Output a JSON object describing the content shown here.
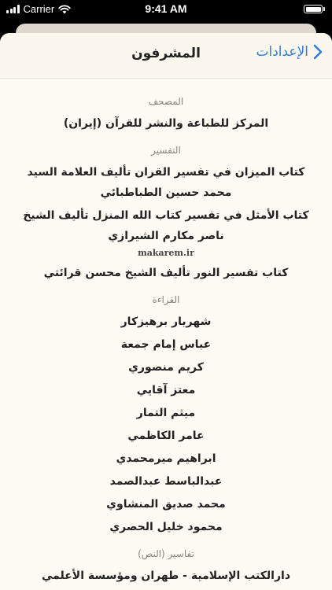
{
  "status_bar": {
    "carrier": "Carrier",
    "time": "9:41 AM",
    "battery_percent": 100,
    "icons": [
      "signal-bars-icon",
      "wifi-icon",
      "battery-icon"
    ]
  },
  "nav": {
    "title": "المشرفون",
    "back_label": "الإعدادات",
    "back_icon": "chevron-right-icon",
    "accent_color": "#2f7fd8"
  },
  "sections": [
    {
      "header": "المصحف",
      "items": [
        "المركز للطباعة والنشر للقرآن (إيران)"
      ]
    },
    {
      "header": "التفسير",
      "items": [
        "كتاب الميزان في تفسير القران تأليف العلامة السيد محمد حسين الطباطبائي",
        "كتاب الأمثل في تفسير كتاب الله المنزل تأليف الشيخ ناصر مكارم الشيرازي"
      ],
      "note": "makarem.ir",
      "items_after": [
        "كتاب تفسير النور تأليف الشيخ محسن قرائتي"
      ]
    },
    {
      "header": "القراءة",
      "items": [
        "شهريار برهيزكار",
        "عباس إمام جمعة",
        "كريم منصوري",
        "معتز آقايي",
        "ميثم التمار",
        "عامر الكاظمي",
        "ابراهيم ميرمحمدي",
        "عبدالباسط عبدالصمد",
        "محمد صديق المنشاوي",
        "محمود خليل الحصري"
      ]
    },
    {
      "header": "تفاسير (النص)",
      "items": [
        "دارالكتب الإسلامية - طهران ومؤسسة الأعلمي للمطبوعات"
      ]
    }
  ]
}
